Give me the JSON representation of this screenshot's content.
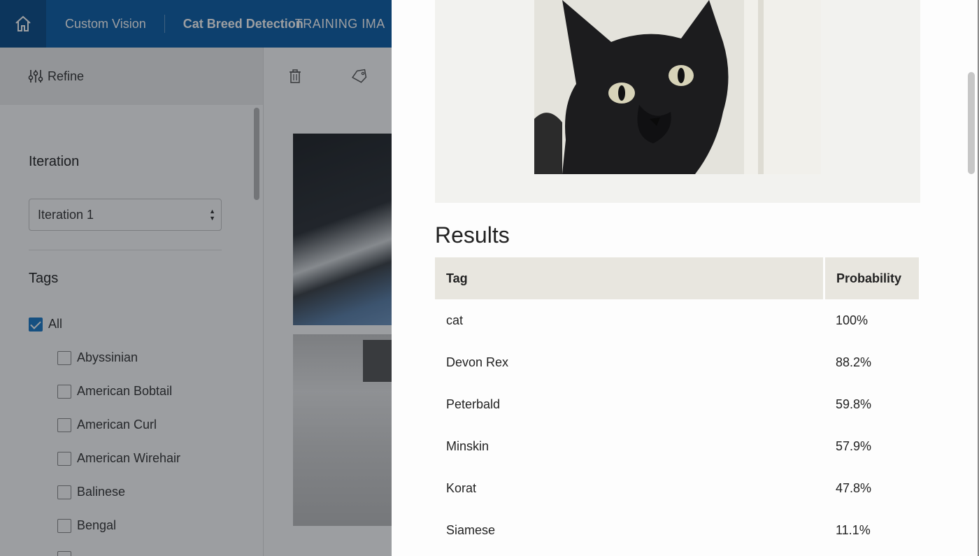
{
  "topbar": {
    "home_icon": "home-icon",
    "app_name": "Custom Vision",
    "project_name": "Cat Breed Detection",
    "section_name": "TRAINING IMA"
  },
  "sidebar": {
    "refine_label": "Refine",
    "iteration_title": "Iteration",
    "iteration_selected": "Iteration 1",
    "tags_title": "Tags",
    "all_label": "All",
    "tags": [
      {
        "label": "Abyssinian"
      },
      {
        "label": "American Bobtail"
      },
      {
        "label": "American Curl"
      },
      {
        "label": "American Wirehair"
      },
      {
        "label": "Balinese"
      },
      {
        "label": "Bengal"
      }
    ]
  },
  "toolbar": {
    "delete_icon": "trash-icon",
    "tag_icon": "tag-icon"
  },
  "dialog": {
    "results_title": "Results",
    "columns": [
      "Tag",
      "Probability"
    ],
    "rows": [
      {
        "tag": "cat",
        "probability": "100%"
      },
      {
        "tag": "Devon Rex",
        "probability": "88.2%"
      },
      {
        "tag": "Peterbald",
        "probability": "59.8%"
      },
      {
        "tag": "Minskin",
        "probability": "57.9%"
      },
      {
        "tag": "Korat",
        "probability": "47.8%"
      },
      {
        "tag": "Siamese",
        "probability": "11.1%"
      }
    ]
  },
  "colors": {
    "topbar": "#0a5ea8",
    "home_button": "#084b89",
    "checkbox_checked": "#1979c9",
    "table_header": "#e8e6df"
  }
}
